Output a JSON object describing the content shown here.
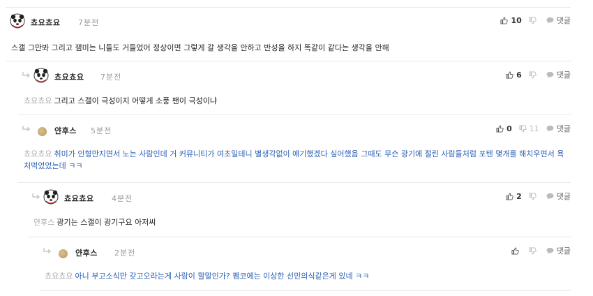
{
  "comments": [
    {
      "author": "쵸요쵸요",
      "time": "7분전",
      "likes": "10",
      "dislikes": "",
      "reply_label": "댓글",
      "mention": "",
      "text": "스갤 그만봐 그리고 잼미는 니들도 거들었어 정상이면 그렇게 갈 생각을 안하고 반성을 하지 똑같이 같다는 생각을 안해"
    },
    {
      "author": "쵸요쵸요",
      "time": "7분전",
      "likes": "6",
      "dislikes": "",
      "reply_label": "댓글",
      "mention": "쵸요쵸요",
      "text": "그리고 스갤이 극성이지 어떻게 소풍 팬이 극성이냐"
    },
    {
      "author": "얀후스",
      "time": "5분전",
      "likes": "0",
      "dislikes": "11",
      "reply_label": "댓글",
      "mention": "쵸요쵸요",
      "text": "취미가 인형만지면서 노는 사람인데 거 커뮤니티가 여초일테니 별생각없이 얘기했겠다 싶어했음 그때도 무슨 광기에 절린 사람들처럼 포텐 몇개를 해치우면서 욕처먹었었는데 ㅋㅋ"
    },
    {
      "author": "쵸요쵸요",
      "time": "4분전",
      "likes": "2",
      "dislikes": "",
      "reply_label": "댓글",
      "mention": "얀후스",
      "text": "광기는 스갤이 광기구요 아저씨"
    },
    {
      "author": "얀후스",
      "time": "2분전",
      "likes": "",
      "dislikes": "",
      "reply_label": "댓글",
      "mention": "쵸요쵸요",
      "text": "아니 부고소식만 갖고오라는게 사람이 할말인가? 펨코에는 이상한 선민의식같은게 있네 ㅋㅋ"
    }
  ],
  "icons": {
    "like": "thumbs-up-icon",
    "dislike": "thumbs-down-icon",
    "reply": "speech-bubble-icon",
    "reply_arrow": "reply-arrow-icon",
    "avatar_panda": "panda-avatar",
    "avatar_dot": "dot-avatar"
  },
  "colors": {
    "blue_text": "#2a5fb5",
    "mention": "#a9a9a9",
    "time": "#999999",
    "divider": "#e9e9e9"
  }
}
